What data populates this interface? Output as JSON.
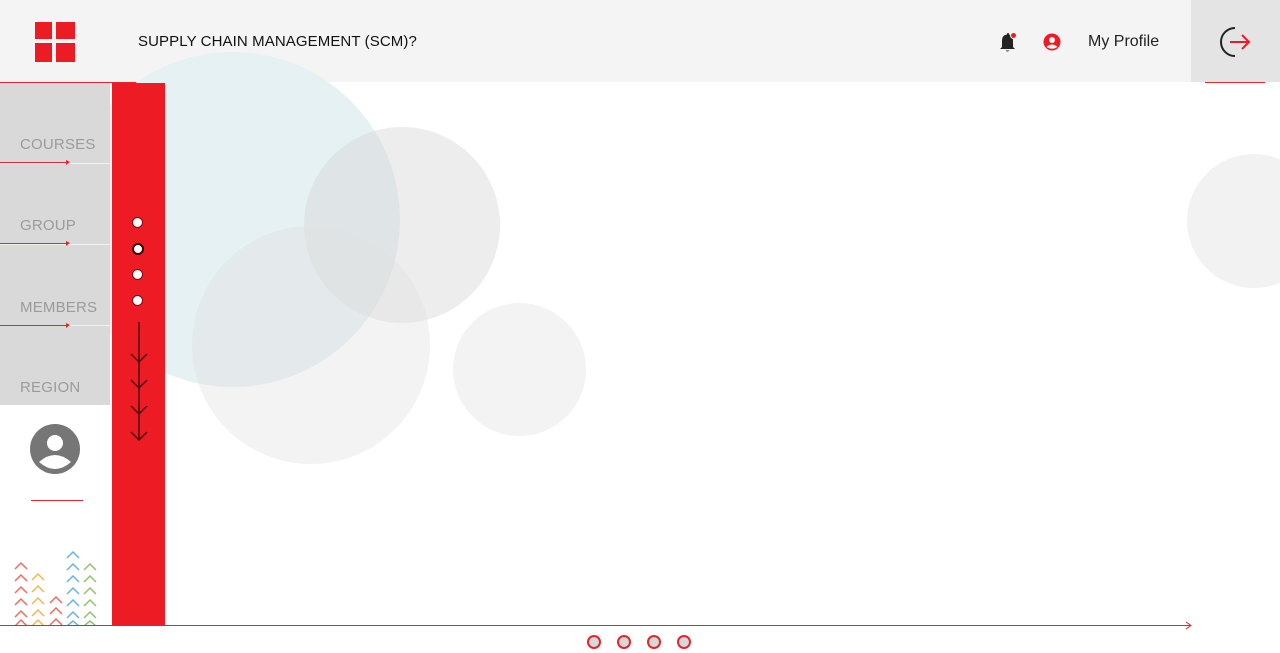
{
  "header": {
    "title": "SUPPLY CHAIN MANAGEMENT (SCM)?",
    "profile_label": "My Profile",
    "icons": [
      "app-logo-icon",
      "bell-icon",
      "user-circle-icon",
      "logout-icon"
    ]
  },
  "sidebar": {
    "items": [
      {
        "label": "COURSES"
      },
      {
        "label": "GROUP"
      },
      {
        "label": "MEMBERS"
      },
      {
        "label": "REGION"
      }
    ],
    "avatar_icon": "user-avatar-icon"
  },
  "step_nav": {
    "dots": 4,
    "selected_index": 1
  },
  "pager": {
    "dots": 4
  },
  "colors": {
    "accent": "#ed1c24",
    "header_bg": "#f4f4f4",
    "sidebar_bg": "#d9d9d9",
    "label_gray": "#9b9b9b"
  }
}
